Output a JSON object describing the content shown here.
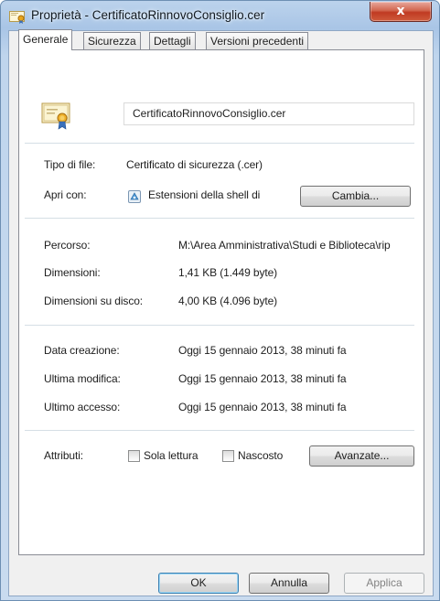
{
  "window": {
    "title": "Proprietà - CertificatoRinnovoConsiglio.cer",
    "close_glyph": "x"
  },
  "tabs": [
    {
      "label": "Generale",
      "active": true
    },
    {
      "label": "Sicurezza",
      "active": false
    },
    {
      "label": "Dettagli",
      "active": false
    },
    {
      "label": "Versioni precedenti",
      "active": false
    }
  ],
  "general": {
    "file_name": "CertificatoRinnovoConsiglio.cer",
    "type_label": "Tipo di file:",
    "type_value": "Certificato di sicurezza (.cer)",
    "open_with_label": "Apri con:",
    "open_with_value": "Estensioni della shell di",
    "change_button": "Cambia...",
    "path_label": "Percorso:",
    "path_value": "M:\\Area Amministrativa\\Studi e Biblioteca\\rip",
    "size_label": "Dimensioni:",
    "size_value": "1,41 KB (1.449 byte)",
    "disk_size_label": "Dimensioni su disco:",
    "disk_size_value": "4,00 KB (4.096 byte)",
    "created_label": "Data creazione:",
    "created_value": "Oggi 15 gennaio 2013, 38 minuti fa",
    "modified_label": "Ultima modifica:",
    "modified_value": "Oggi 15 gennaio 2013, 38 minuti fa",
    "accessed_label": "Ultimo accesso:",
    "accessed_value": "Oggi 15 gennaio 2013, 38 minuti fa",
    "attributes_label": "Attributi:",
    "readonly_label": "Sola lettura",
    "readonly_checked": false,
    "hidden_label": "Nascosto",
    "hidden_checked": false,
    "advanced_button": "Avanzate..."
  },
  "footer": {
    "ok": "OK",
    "cancel": "Annulla",
    "apply": "Applica"
  },
  "icons": {
    "title": "certificate-icon",
    "file": "certificate-file-icon",
    "open_with": "shell-extension-icon"
  }
}
